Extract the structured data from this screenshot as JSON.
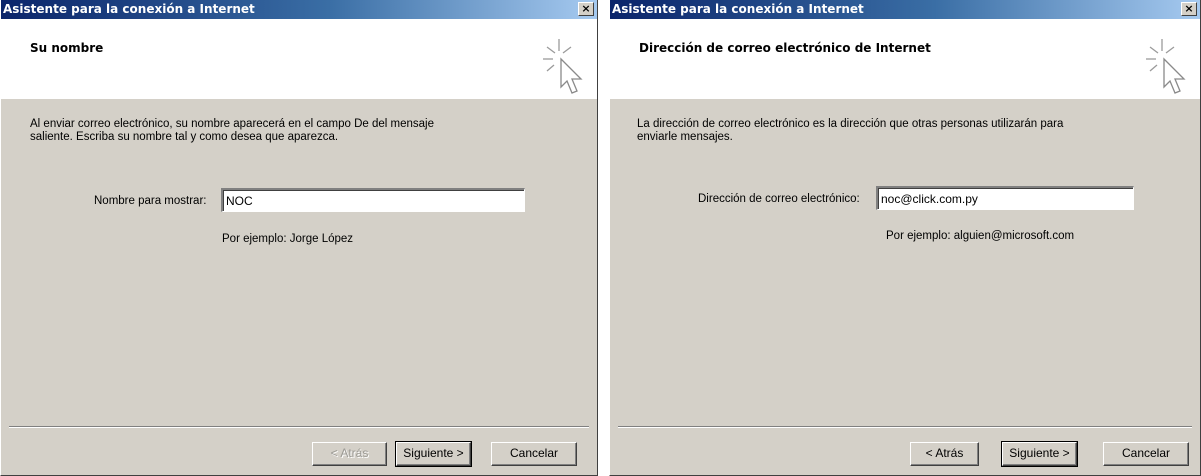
{
  "window1": {
    "title": "Asistente para la conexión a Internet",
    "close_glyph": "×",
    "header_title": "Su nombre",
    "description_line1": "Al enviar correo electrónico, su nombre aparecerá en el campo De del mensaje",
    "description_line2": "saliente. Escriba su nombre tal y como desea que aparezca.",
    "field_label": "Nombre para mostrar:",
    "field_value": "NOC",
    "example": "Por ejemplo: Jorge López",
    "buttons": {
      "back": "< Atrás",
      "next": "Siguiente >",
      "cancel": "Cancelar"
    }
  },
  "window2": {
    "title": "Asistente para la conexión a Internet",
    "close_glyph": "×",
    "header_title": "Dirección de correo electrónico de Internet",
    "description_line1": "La dirección de correo electrónico es la dirección que otras personas utilizarán para",
    "description_line2": "enviarle mensajes.",
    "field_label": "Dirección de correo electrónico:",
    "field_value": "noc@click.com.py",
    "example": "Por ejemplo: alguien@microsoft.com",
    "buttons": {
      "back": "< Atrás",
      "next": "Siguiente >",
      "cancel": "Cancelar"
    }
  },
  "icons": {
    "header": "wizard-sparkle-cursor-icon"
  }
}
